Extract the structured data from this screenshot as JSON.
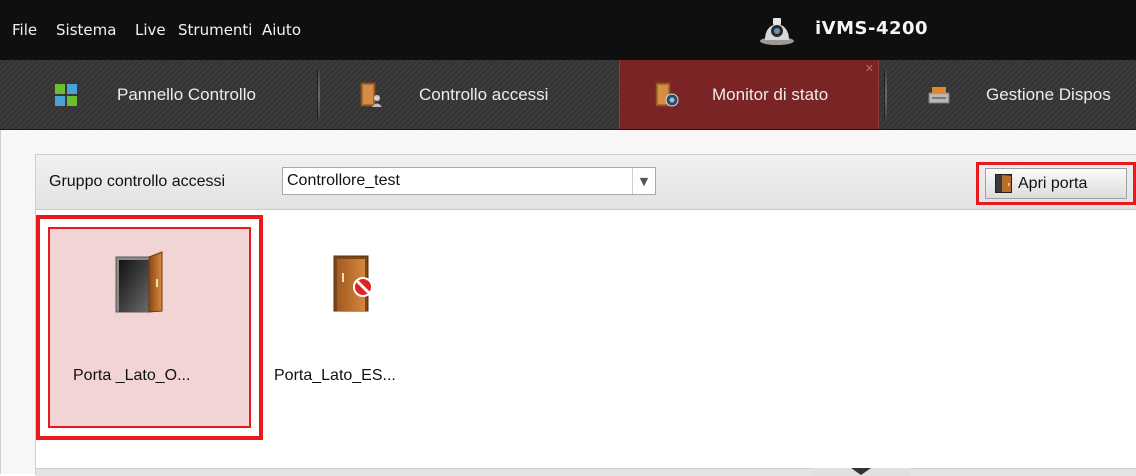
{
  "menu": {
    "items": [
      "File",
      "Sistema",
      "Live",
      "Strumenti",
      "Aiuto"
    ]
  },
  "app": {
    "title": "iVMS-4200",
    "logo_icon": "camera-logo-icon"
  },
  "tabs": [
    {
      "label": "Pannello Controllo",
      "icon": "grid-icon",
      "active": false
    },
    {
      "label": "Controllo accessi",
      "icon": "door-user-icon",
      "active": false
    },
    {
      "label": "Monitor di stato",
      "icon": "door-camera-icon",
      "active": true
    },
    {
      "label": "Gestione Dispos",
      "icon": "device-icon",
      "active": false
    }
  ],
  "toolbar": {
    "group_label": "Gruppo controllo accessi",
    "group_value": "Controllore_test",
    "open_door_label": "Apri porta"
  },
  "doors": [
    {
      "label": "Porta _Lato_O...",
      "status": "open",
      "selected": true
    },
    {
      "label": "Porta_Lato_ES...",
      "status": "closed-forbidden",
      "selected": false
    }
  ],
  "colors": {
    "highlight": "#e8191f",
    "active_tab": "#7a2426",
    "selected_item_bg": "#f3d4d4"
  }
}
